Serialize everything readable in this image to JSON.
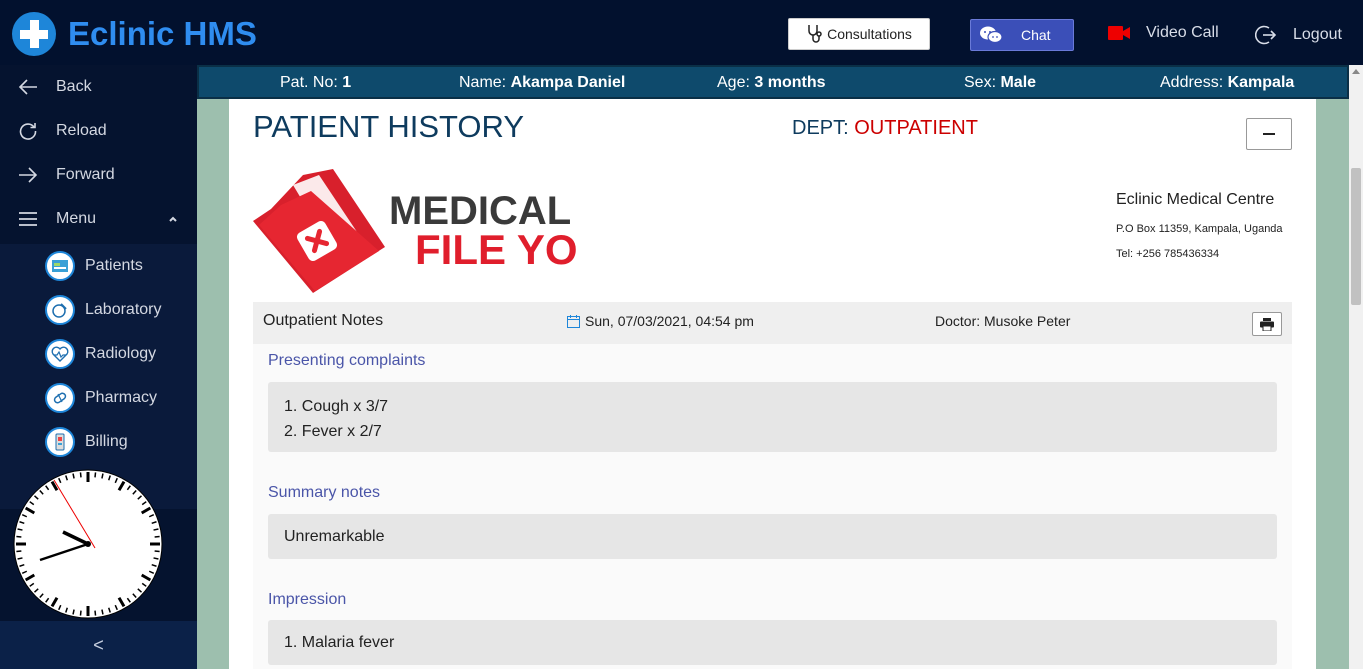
{
  "app": {
    "title": "Eclinic HMS"
  },
  "topbar": {
    "consultations_label": "Consultations",
    "chat_label": "Chat",
    "video_call_label": "Video Call",
    "logout_label": "Logout"
  },
  "sidebar": {
    "back": "Back",
    "reload": "Reload",
    "forward": "Forward",
    "menu": "Menu",
    "items": [
      {
        "label": "Patients",
        "icon": "patients-icon"
      },
      {
        "label": "Laboratory",
        "icon": "laboratory-icon"
      },
      {
        "label": "Radiology",
        "icon": "radiology-icon"
      },
      {
        "label": "Pharmacy",
        "icon": "pharmacy-icon"
      },
      {
        "label": "Billing",
        "icon": "billing-icon"
      }
    ],
    "collapse_glyph": "<"
  },
  "patient": {
    "no_label": "Pat. No:",
    "no": "1",
    "name_label": "Name:",
    "name": "Akampa Daniel",
    "age_label": "Age:",
    "age": "3 months",
    "sex_label": "Sex:",
    "sex": "Male",
    "address_label": "Address:",
    "address": "Kampala"
  },
  "page": {
    "title": "PATIENT HISTORY",
    "dept_label": "DEPT:",
    "dept": "OUTPATIENT"
  },
  "logo": {
    "line1": "MEDICAL",
    "line2": "FILE YO"
  },
  "clinic": {
    "name": "Eclinic Medical Centre",
    "address": "P.O Box 11359, Kampala, Uganda",
    "tel": "Tel: +256 785436334"
  },
  "notes": {
    "title": "Outpatient Notes",
    "date": "Sun, 07/03/2021, 04:54 pm",
    "doctor": "Doctor: Musoke Peter",
    "presenting_label": "Presenting complaints",
    "presenting": [
      "1. Cough x 3/7",
      "2. Fever x 2/7"
    ],
    "summary_label": "Summary notes",
    "summary": "Unremarkable",
    "impression_label": "Impression",
    "impression": "1. Malaria fever"
  },
  "colors": {
    "topbar": "#02112e",
    "brand": "#2f8df0",
    "patient_bar": "#0e4a6c",
    "accent_red": "#cc0000",
    "section_label": "#4a55a8"
  }
}
